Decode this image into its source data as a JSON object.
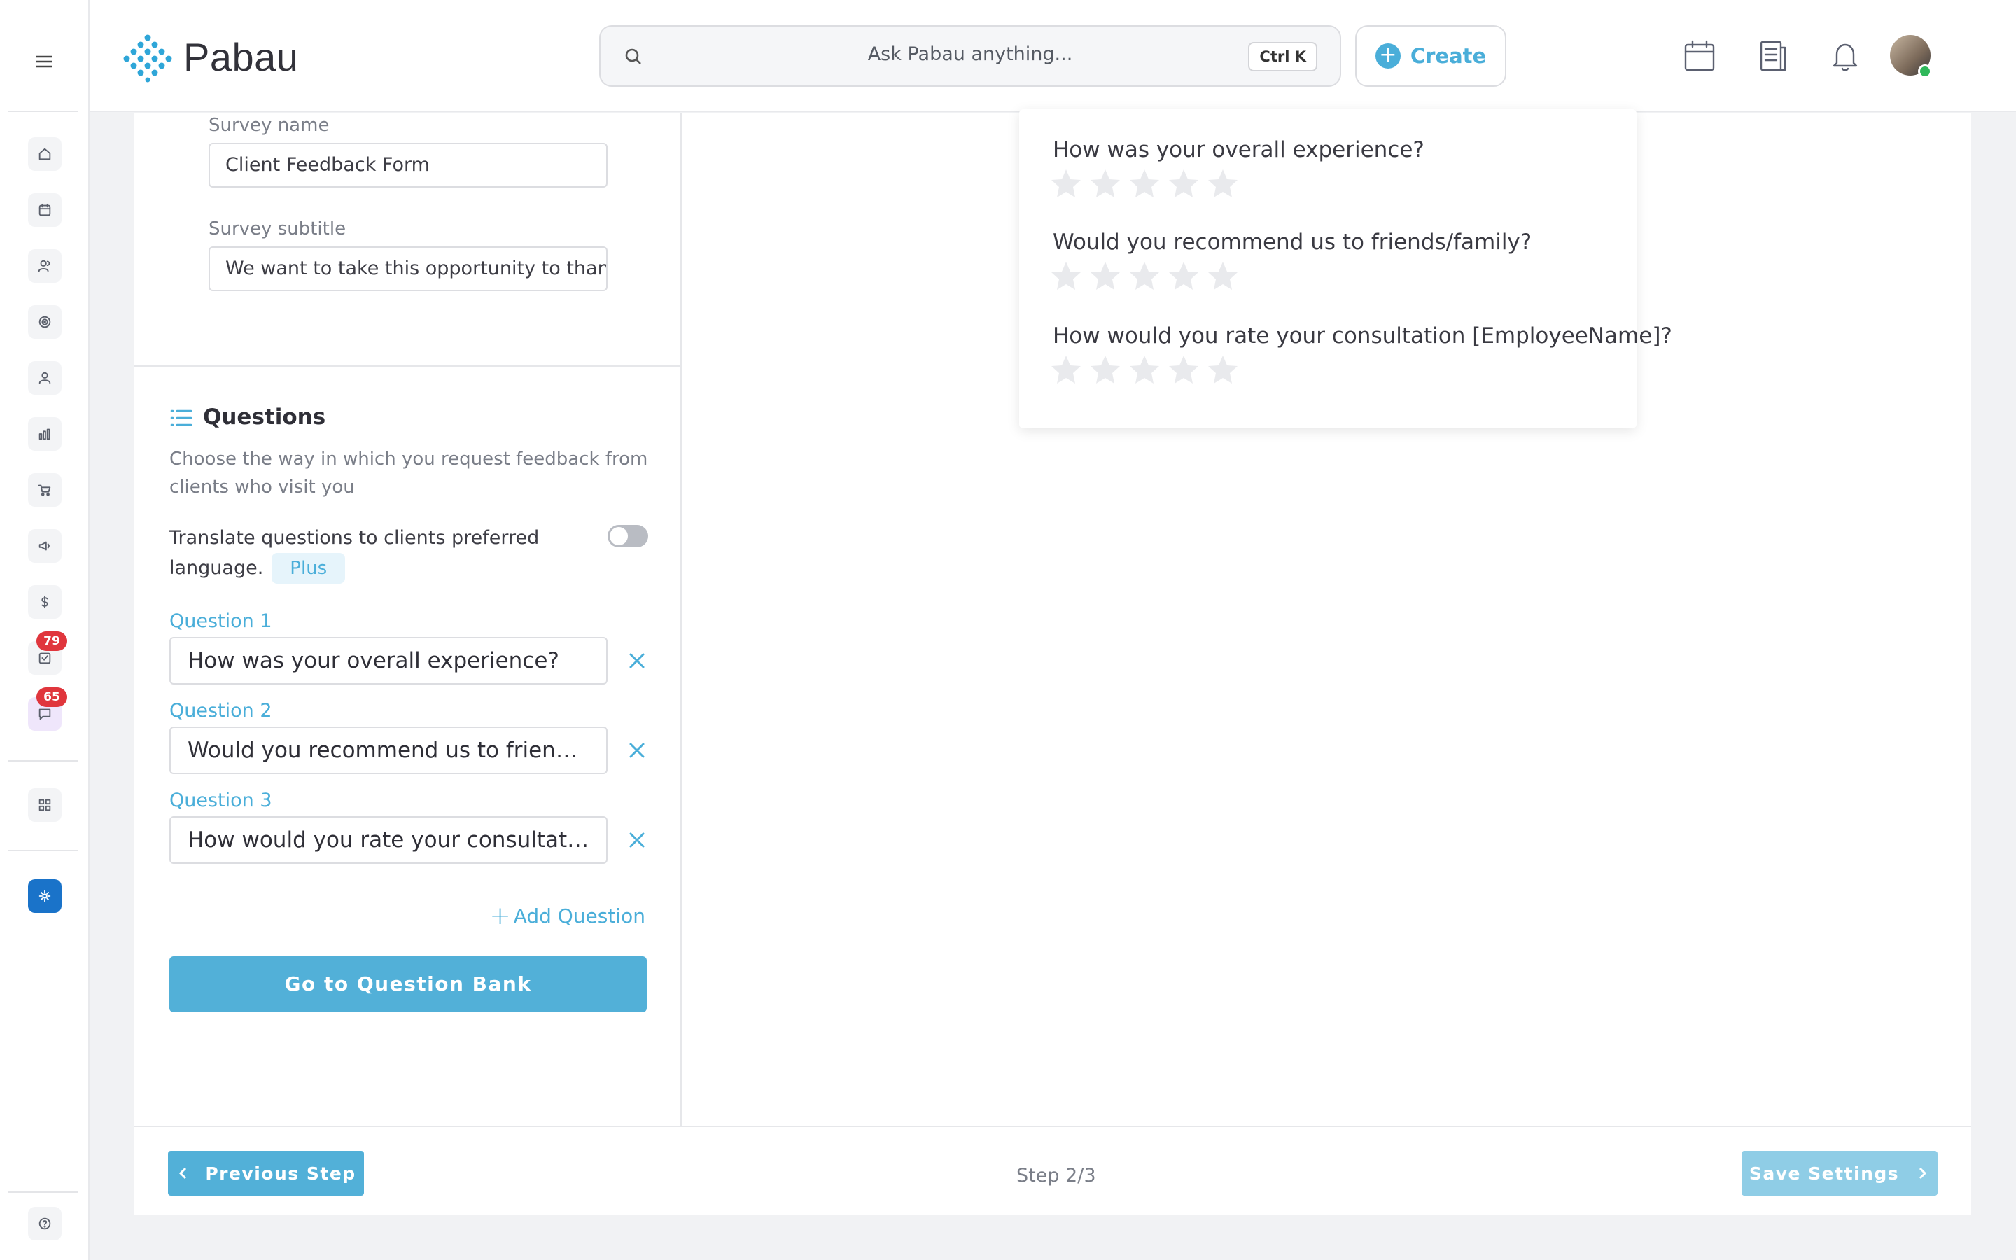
{
  "app": {
    "brand": "Pabau",
    "brand_color": "#4aaed9"
  },
  "search": {
    "placeholder": "Ask Pabau anything...",
    "shortcut": "Ctrl K"
  },
  "header": {
    "create_label": "Create",
    "icons": [
      "calendar-icon",
      "receipt-icon",
      "bell-icon",
      "avatar",
      "chevron-down-icon"
    ]
  },
  "sidebar": {
    "items": [
      {
        "name": "home-icon"
      },
      {
        "name": "calendar-icon"
      },
      {
        "name": "clients-icon"
      },
      {
        "name": "target-icon"
      },
      {
        "name": "user-icon"
      },
      {
        "name": "reports-icon"
      },
      {
        "name": "cart-icon"
      },
      {
        "name": "megaphone-icon"
      },
      {
        "name": "dollar-icon"
      },
      {
        "name": "tasks-icon",
        "badge": "79"
      },
      {
        "name": "chat-icon",
        "badge": "65"
      },
      {
        "name": "apps-grid-icon"
      },
      {
        "name": "settings-icon"
      },
      {
        "name": "help-icon"
      }
    ]
  },
  "survey": {
    "name_label": "Survey name",
    "name_value": "Client Feedback Form",
    "subtitle_label": "Survey subtitle",
    "subtitle_value": "We want to take this opportunity to thank"
  },
  "questions": {
    "title": "Questions",
    "description": "Choose the way in which you request feedback from clients who visit you",
    "translate_text": "Translate questions to clients preferred language.",
    "translate_badge": "Plus",
    "translate_enabled": false,
    "items": [
      {
        "label": "Question 1",
        "value": "How was your overall experience?"
      },
      {
        "label": "Question 2",
        "value": "Would you recommend us to friends/family?"
      },
      {
        "label": "Question 3",
        "value": "How would you rate your consultation [EmployeeName]?"
      }
    ],
    "add_label": "Add Question",
    "bank_label": "Go to Question Bank"
  },
  "preview": {
    "questions": [
      "How was your overall experience?",
      "Would you recommend us to friends/family?",
      "How would you rate your consultation [EmployeeName]?"
    ],
    "stars_per_question": 5,
    "star_color": "#e9eaed"
  },
  "footer": {
    "prev_label": "Previous Step",
    "step_text": "Step 2/3",
    "save_label": "Save Settings"
  }
}
